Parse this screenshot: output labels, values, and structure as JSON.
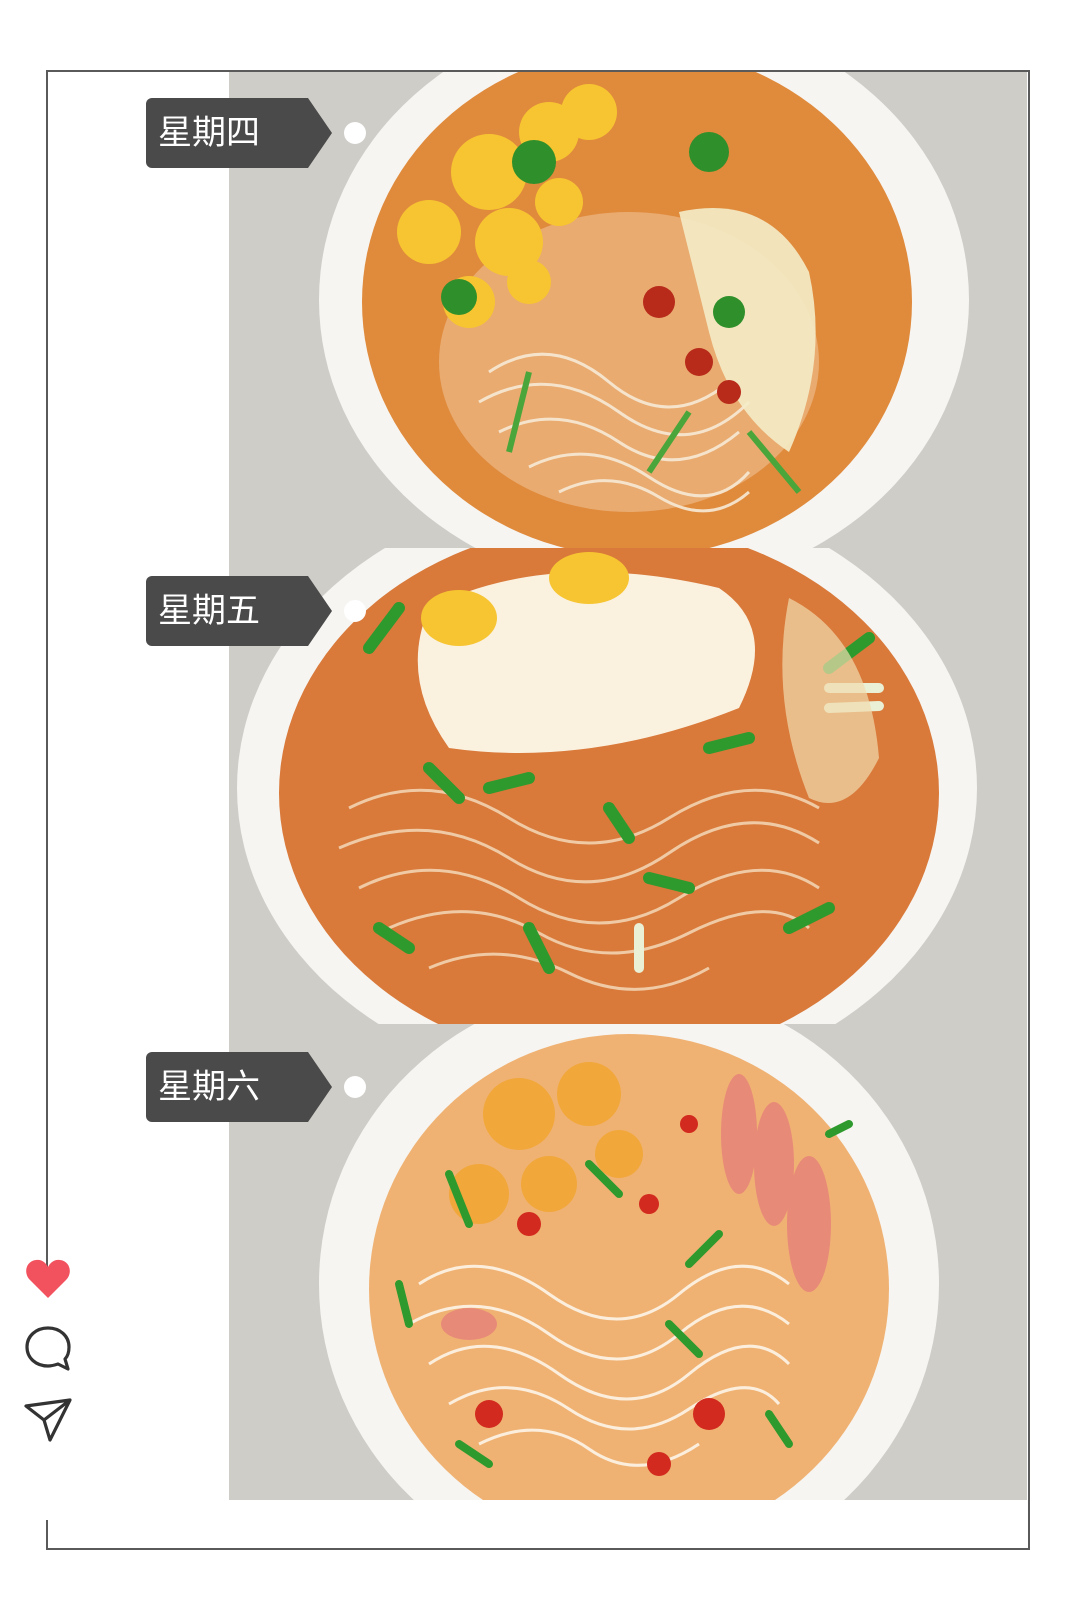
{
  "days": [
    {
      "label": "星期四"
    },
    {
      "label": "星期五"
    },
    {
      "label": "星期六"
    }
  ],
  "actions": {
    "like_icon": "heart-icon",
    "comment_icon": "comment-icon",
    "share_icon": "send-icon"
  },
  "colors": {
    "label_bg": "#4a4a4a",
    "heart": "#f2515e",
    "frame": "#5a5a5a"
  }
}
